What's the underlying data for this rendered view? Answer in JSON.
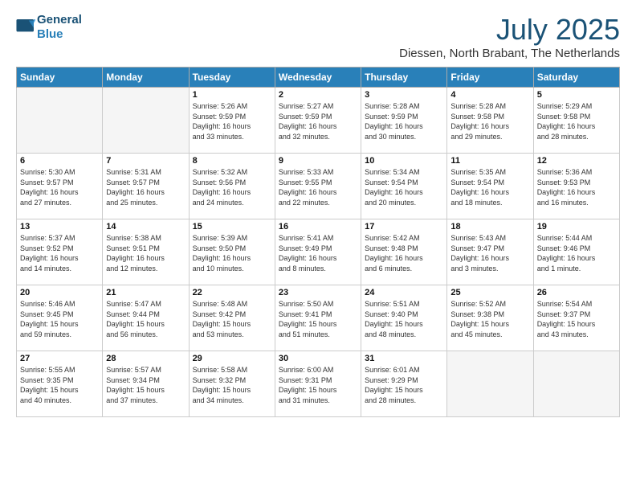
{
  "logo": {
    "line1": "General",
    "line2": "Blue"
  },
  "title": "July 2025",
  "subtitle": "Diessen, North Brabant, The Netherlands",
  "headers": [
    "Sunday",
    "Monday",
    "Tuesday",
    "Wednesday",
    "Thursday",
    "Friday",
    "Saturday"
  ],
  "weeks": [
    [
      {
        "day": "",
        "info": ""
      },
      {
        "day": "",
        "info": ""
      },
      {
        "day": "1",
        "info": "Sunrise: 5:26 AM\nSunset: 9:59 PM\nDaylight: 16 hours\nand 33 minutes."
      },
      {
        "day": "2",
        "info": "Sunrise: 5:27 AM\nSunset: 9:59 PM\nDaylight: 16 hours\nand 32 minutes."
      },
      {
        "day": "3",
        "info": "Sunrise: 5:28 AM\nSunset: 9:59 PM\nDaylight: 16 hours\nand 30 minutes."
      },
      {
        "day": "4",
        "info": "Sunrise: 5:28 AM\nSunset: 9:58 PM\nDaylight: 16 hours\nand 29 minutes."
      },
      {
        "day": "5",
        "info": "Sunrise: 5:29 AM\nSunset: 9:58 PM\nDaylight: 16 hours\nand 28 minutes."
      }
    ],
    [
      {
        "day": "6",
        "info": "Sunrise: 5:30 AM\nSunset: 9:57 PM\nDaylight: 16 hours\nand 27 minutes."
      },
      {
        "day": "7",
        "info": "Sunrise: 5:31 AM\nSunset: 9:57 PM\nDaylight: 16 hours\nand 25 minutes."
      },
      {
        "day": "8",
        "info": "Sunrise: 5:32 AM\nSunset: 9:56 PM\nDaylight: 16 hours\nand 24 minutes."
      },
      {
        "day": "9",
        "info": "Sunrise: 5:33 AM\nSunset: 9:55 PM\nDaylight: 16 hours\nand 22 minutes."
      },
      {
        "day": "10",
        "info": "Sunrise: 5:34 AM\nSunset: 9:54 PM\nDaylight: 16 hours\nand 20 minutes."
      },
      {
        "day": "11",
        "info": "Sunrise: 5:35 AM\nSunset: 9:54 PM\nDaylight: 16 hours\nand 18 minutes."
      },
      {
        "day": "12",
        "info": "Sunrise: 5:36 AM\nSunset: 9:53 PM\nDaylight: 16 hours\nand 16 minutes."
      }
    ],
    [
      {
        "day": "13",
        "info": "Sunrise: 5:37 AM\nSunset: 9:52 PM\nDaylight: 16 hours\nand 14 minutes."
      },
      {
        "day": "14",
        "info": "Sunrise: 5:38 AM\nSunset: 9:51 PM\nDaylight: 16 hours\nand 12 minutes."
      },
      {
        "day": "15",
        "info": "Sunrise: 5:39 AM\nSunset: 9:50 PM\nDaylight: 16 hours\nand 10 minutes."
      },
      {
        "day": "16",
        "info": "Sunrise: 5:41 AM\nSunset: 9:49 PM\nDaylight: 16 hours\nand 8 minutes."
      },
      {
        "day": "17",
        "info": "Sunrise: 5:42 AM\nSunset: 9:48 PM\nDaylight: 16 hours\nand 6 minutes."
      },
      {
        "day": "18",
        "info": "Sunrise: 5:43 AM\nSunset: 9:47 PM\nDaylight: 16 hours\nand 3 minutes."
      },
      {
        "day": "19",
        "info": "Sunrise: 5:44 AM\nSunset: 9:46 PM\nDaylight: 16 hours\nand 1 minute."
      }
    ],
    [
      {
        "day": "20",
        "info": "Sunrise: 5:46 AM\nSunset: 9:45 PM\nDaylight: 15 hours\nand 59 minutes."
      },
      {
        "day": "21",
        "info": "Sunrise: 5:47 AM\nSunset: 9:44 PM\nDaylight: 15 hours\nand 56 minutes."
      },
      {
        "day": "22",
        "info": "Sunrise: 5:48 AM\nSunset: 9:42 PM\nDaylight: 15 hours\nand 53 minutes."
      },
      {
        "day": "23",
        "info": "Sunrise: 5:50 AM\nSunset: 9:41 PM\nDaylight: 15 hours\nand 51 minutes."
      },
      {
        "day": "24",
        "info": "Sunrise: 5:51 AM\nSunset: 9:40 PM\nDaylight: 15 hours\nand 48 minutes."
      },
      {
        "day": "25",
        "info": "Sunrise: 5:52 AM\nSunset: 9:38 PM\nDaylight: 15 hours\nand 45 minutes."
      },
      {
        "day": "26",
        "info": "Sunrise: 5:54 AM\nSunset: 9:37 PM\nDaylight: 15 hours\nand 43 minutes."
      }
    ],
    [
      {
        "day": "27",
        "info": "Sunrise: 5:55 AM\nSunset: 9:35 PM\nDaylight: 15 hours\nand 40 minutes."
      },
      {
        "day": "28",
        "info": "Sunrise: 5:57 AM\nSunset: 9:34 PM\nDaylight: 15 hours\nand 37 minutes."
      },
      {
        "day": "29",
        "info": "Sunrise: 5:58 AM\nSunset: 9:32 PM\nDaylight: 15 hours\nand 34 minutes."
      },
      {
        "day": "30",
        "info": "Sunrise: 6:00 AM\nSunset: 9:31 PM\nDaylight: 15 hours\nand 31 minutes."
      },
      {
        "day": "31",
        "info": "Sunrise: 6:01 AM\nSunset: 9:29 PM\nDaylight: 15 hours\nand 28 minutes."
      },
      {
        "day": "",
        "info": ""
      },
      {
        "day": "",
        "info": ""
      }
    ]
  ]
}
